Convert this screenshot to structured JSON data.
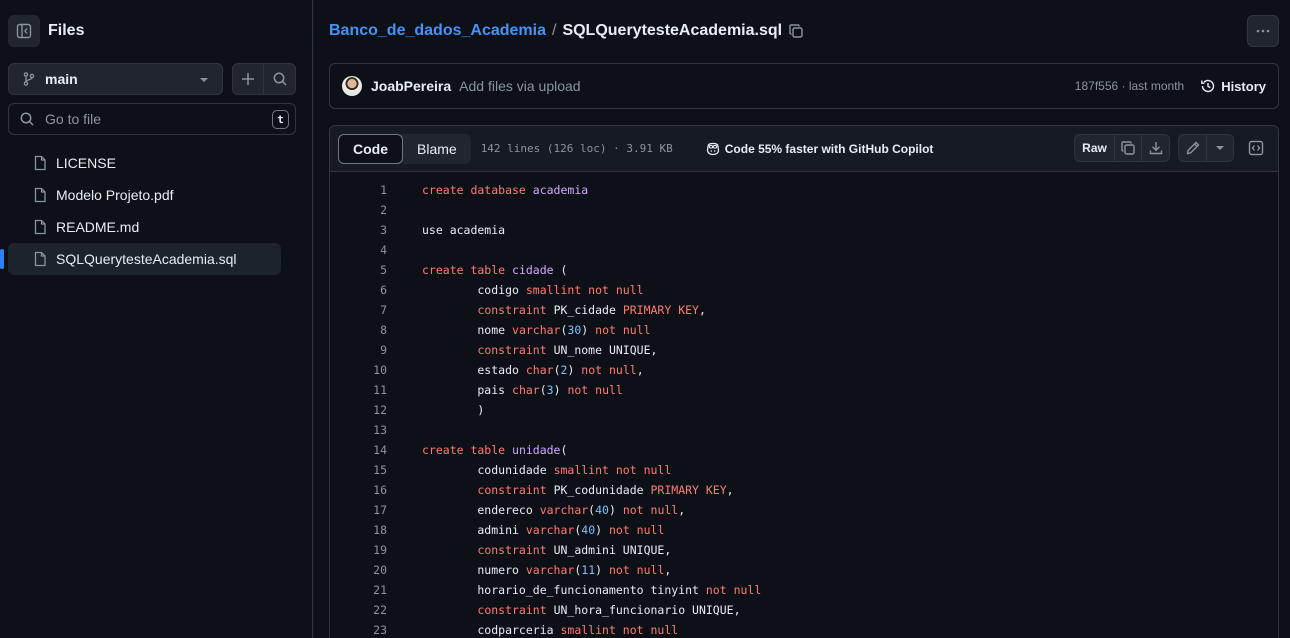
{
  "sidebar": {
    "title": "Files",
    "branch": "main",
    "search_placeholder": "Go to file",
    "search_shortcut": "t",
    "files": [
      {
        "name": "LICENSE",
        "active": false
      },
      {
        "name": "Modelo Projeto.pdf",
        "active": false
      },
      {
        "name": "README.md",
        "active": false
      },
      {
        "name": "SQLQuerytesteAcademia.sql",
        "active": true
      }
    ]
  },
  "breadcrumb": {
    "repo": "Banco_de_dados_Academia",
    "separator": "/",
    "file": "SQLQuerytesteAcademia.sql"
  },
  "commit": {
    "author": "JoabPereira",
    "message": "Add files via upload",
    "hash_time": "187f556 · last month",
    "history_label": "History"
  },
  "file_header": {
    "tabs": [
      "Code",
      "Blame"
    ],
    "active_tab": "Code",
    "meta": "142 lines (126 loc) · 3.91 KB",
    "copilot": "Code 55% faster with GitHub Copilot",
    "raw_label": "Raw"
  },
  "code_lines": [
    [
      [
        "kw",
        "create database "
      ],
      [
        "nm",
        "academia"
      ]
    ],
    [],
    [
      [
        "t",
        "use academia"
      ]
    ],
    [],
    [
      [
        "kw",
        "create table "
      ],
      [
        "nm",
        "cidade"
      ],
      [
        "t",
        " ("
      ]
    ],
    [
      [
        "t",
        "        codigo "
      ],
      [
        "kw",
        "smallint not null"
      ]
    ],
    [
      [
        "t",
        "        "
      ],
      [
        "kw",
        "constraint"
      ],
      [
        "t",
        " PK_cidade "
      ],
      [
        "kw",
        "PRIMARY KEY"
      ],
      [
        "t",
        ","
      ]
    ],
    [
      [
        "t",
        "        nome "
      ],
      [
        "kw",
        "varchar"
      ],
      [
        "t",
        "("
      ],
      [
        "num",
        "30"
      ],
      [
        "t",
        ") "
      ],
      [
        "kw",
        "not null"
      ]
    ],
    [
      [
        "t",
        "        "
      ],
      [
        "kw",
        "constraint"
      ],
      [
        "t",
        " UN_nome UNIQUE,"
      ]
    ],
    [
      [
        "t",
        "        estado "
      ],
      [
        "kw",
        "char"
      ],
      [
        "t",
        "("
      ],
      [
        "num",
        "2"
      ],
      [
        "t",
        ") "
      ],
      [
        "kw",
        "not null"
      ],
      [
        "t",
        ","
      ]
    ],
    [
      [
        "t",
        "        pais "
      ],
      [
        "kw",
        "char"
      ],
      [
        "t",
        "("
      ],
      [
        "num",
        "3"
      ],
      [
        "t",
        ") "
      ],
      [
        "kw",
        "not null"
      ]
    ],
    [
      [
        "t",
        "        )"
      ]
    ],
    [],
    [
      [
        "kw",
        "create table "
      ],
      [
        "nm",
        "unidade"
      ],
      [
        "t",
        "("
      ]
    ],
    [
      [
        "t",
        "        codunidade "
      ],
      [
        "kw",
        "smallint not null"
      ]
    ],
    [
      [
        "t",
        "        "
      ],
      [
        "kw",
        "constraint"
      ],
      [
        "t",
        " PK_codunidade "
      ],
      [
        "kw",
        "PRIMARY KEY"
      ],
      [
        "t",
        ","
      ]
    ],
    [
      [
        "t",
        "        endereco "
      ],
      [
        "kw",
        "varchar"
      ],
      [
        "t",
        "("
      ],
      [
        "num",
        "40"
      ],
      [
        "t",
        ") "
      ],
      [
        "kw",
        "not null"
      ],
      [
        "t",
        ","
      ]
    ],
    [
      [
        "t",
        "        admini "
      ],
      [
        "kw",
        "varchar"
      ],
      [
        "t",
        "("
      ],
      [
        "num",
        "40"
      ],
      [
        "t",
        ") "
      ],
      [
        "kw",
        "not null"
      ]
    ],
    [
      [
        "t",
        "        "
      ],
      [
        "kw",
        "constraint"
      ],
      [
        "t",
        " UN_admini UNIQUE,"
      ]
    ],
    [
      [
        "t",
        "        numero "
      ],
      [
        "kw",
        "varchar"
      ],
      [
        "t",
        "("
      ],
      [
        "num",
        "11"
      ],
      [
        "t",
        ") "
      ],
      [
        "kw",
        "not null"
      ],
      [
        "t",
        ","
      ]
    ],
    [
      [
        "t",
        "        horario_de_funcionamento tinyint "
      ],
      [
        "kw",
        "not null"
      ]
    ],
    [
      [
        "t",
        "        "
      ],
      [
        "kw",
        "constraint"
      ],
      [
        "t",
        " UN_hora_funcionario UNIQUE,"
      ]
    ],
    [
      [
        "t",
        "        codparceria "
      ],
      [
        "kw",
        "smallint not null"
      ]
    ]
  ]
}
